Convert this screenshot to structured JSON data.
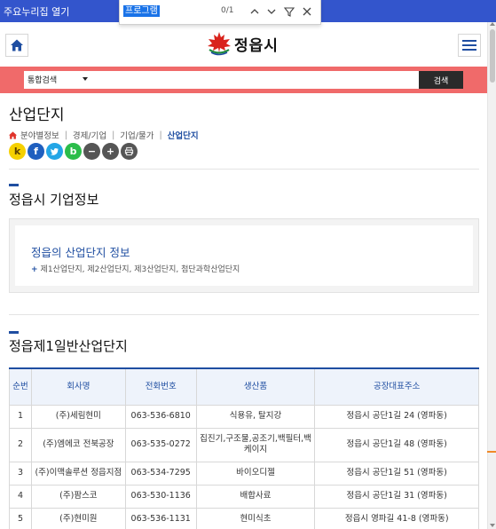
{
  "skipbar": {
    "text": "주요누리집 열기"
  },
  "find": {
    "query": "프로그램",
    "count": "0/1"
  },
  "header": {
    "logo_text": "정읍시"
  },
  "search": {
    "select_value": "통합검색",
    "button_label": "검색"
  },
  "page": {
    "title": "산업단지"
  },
  "breadcrumb": {
    "items": [
      "분야별정보",
      "경제/기업",
      "기업/물가"
    ],
    "current": "산업단지"
  },
  "shares": {
    "kakao": "k",
    "facebook": "f",
    "twitter": "t",
    "band": "b",
    "minus": "−",
    "plus": "+",
    "print": "⎙"
  },
  "section1": {
    "title": "정읍시 기업정보"
  },
  "infobox": {
    "title": "정읍의 산업단지 정보",
    "sub": "제1산업단지, 제2산업단지, 제3산업단지, 첨단과학산업단지"
  },
  "section2": {
    "title": "정읍제1일반산업단지"
  },
  "table": {
    "headers": [
      "순번",
      "회사명",
      "전화번호",
      "생산품",
      "공장대표주소"
    ],
    "rows": [
      [
        "1",
        "(주)세림현미",
        "063-536-6810",
        "식용유, 탈지강",
        "정읍시 공단1길 24 (영파동)"
      ],
      [
        "2",
        "(주)엠에코 전북공장",
        "063-535-0272",
        "집진기,구조물,공조기,백필터,백케이지",
        "정읍시 공단1길 48 (영파동)"
      ],
      [
        "3",
        "(주)이맥솔루션 정읍지점",
        "063-534-7295",
        "바이오디젤",
        "정읍시 공단1길 51 (영파동)"
      ],
      [
        "4",
        "(주)팜스코",
        "063-530-1136",
        "배합사료",
        "정읍시 공단1길 31 (영파동)"
      ],
      [
        "5",
        "(주)현미원",
        "063-536-1131",
        "현미식초",
        "정읍시 영파길 41-8 (영파동)"
      ]
    ]
  },
  "colors": {
    "accent": "#1f4ea1",
    "search_band": "#f06a6a",
    "skipbar": "#3355cc"
  }
}
